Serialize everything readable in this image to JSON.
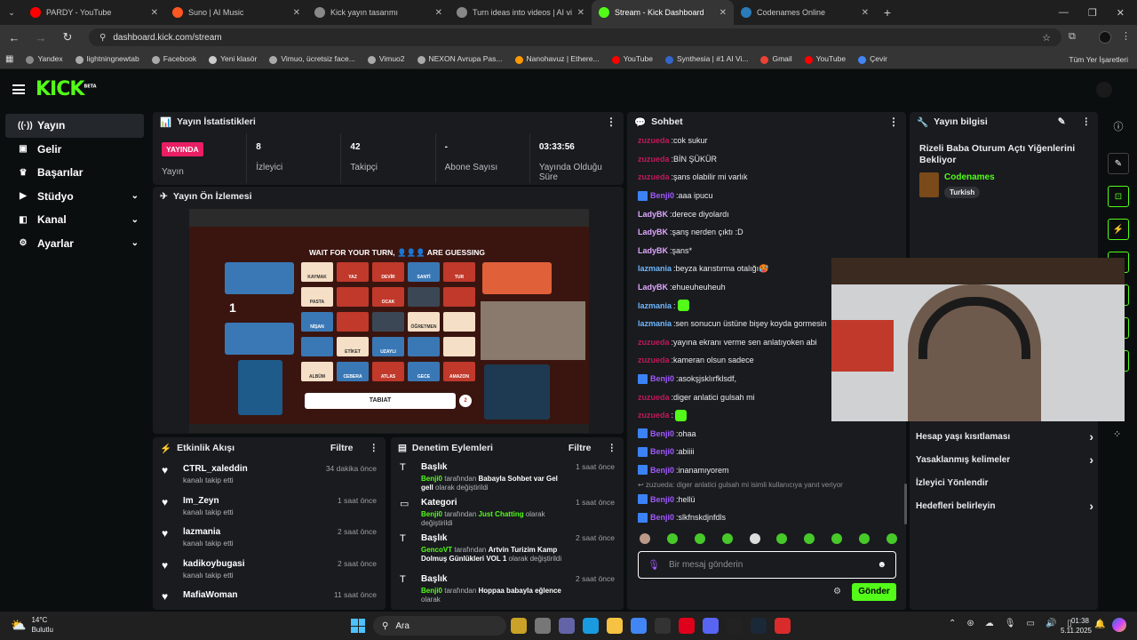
{
  "browser": {
    "tabs": [
      {
        "title": "PARDY - YouTube",
        "color": "#ff0000",
        "active": false
      },
      {
        "title": "Suno | AI Music",
        "color": "#ff5722",
        "active": false
      },
      {
        "title": "Kick yayın tasarımı",
        "color": "#888888",
        "active": false
      },
      {
        "title": "Turn ideas into videos | AI vide",
        "color": "#888888",
        "active": false
      },
      {
        "title": "Stream - Kick Dashboard",
        "color": "#53fc18",
        "active": true
      },
      {
        "title": "Codenames Online",
        "color": "#2b7bb9",
        "active": false
      }
    ],
    "url": "dashboard.kick.com/stream",
    "bookmarks": [
      "Yandex",
      "lightningnewtab",
      "Facebook",
      "Yeni klasör",
      "Vimuo, ücretsiz face...",
      "Vimuo2",
      "NEXON Avrupa Pas...",
      "Nanohavuz | Ethere...",
      "YouTube",
      "Synthesia | #1 AI Vi...",
      "Gmail",
      "YouTube",
      "Çevir"
    ],
    "all_bookmarks": "Tüm Yer İşaretleri"
  },
  "logo": {
    "text": "KICK",
    "tag": "BETA"
  },
  "sidebar": [
    {
      "label": "Yayın",
      "icon": "stream-icon",
      "glyph": "((·))",
      "active": true,
      "chevron": false
    },
    {
      "label": "Gelir",
      "icon": "wallet-icon",
      "glyph": "▣",
      "active": false,
      "chevron": false
    },
    {
      "label": "Başarılar",
      "icon": "trophy-icon",
      "glyph": "♛",
      "active": false,
      "chevron": false
    },
    {
      "label": "Stüdyo",
      "icon": "video-icon",
      "glyph": "▶",
      "active": false,
      "chevron": true
    },
    {
      "label": "Kanal",
      "icon": "channel-icon",
      "glyph": "◧",
      "active": false,
      "chevron": true
    },
    {
      "label": "Ayarlar",
      "icon": "gear-icon",
      "glyph": "⚙",
      "active": false,
      "chevron": true
    }
  ],
  "stats": {
    "title": "Yayın İstatistikleri",
    "live_badge": "YAYINDA",
    "items": [
      {
        "value": "8",
        "label": "İzleyici"
      },
      {
        "value": "42",
        "label": "Takipçi"
      },
      {
        "value": "-",
        "label": "Abone Sayısı"
      },
      {
        "value": "03:33:56",
        "label": "Yayında Olduğu Süre"
      }
    ],
    "live_label": "Yayın"
  },
  "preview": {
    "title": "Yayın Ön İzlemesi",
    "game_heading": "WAIT FOR YOUR TURN, 👤👤👤 ARE GUESSING",
    "clue": "TABIAT",
    "clue_count": "2",
    "team_score": "1",
    "cards": [
      "KAYMAK",
      "YAZ",
      "DEVİR",
      "SANTİ",
      "TUR",
      "PASTA",
      "",
      "OCAK",
      "",
      "",
      "NİŞAN",
      "",
      "",
      "ÖĞRETMEN",
      "",
      "",
      "ETİKET",
      "UZAYLI",
      "",
      "",
      "ALBÜM",
      "CEBERA",
      "ATLAS",
      "GECE",
      "AMAZON"
    ],
    "card_colors": [
      "cream",
      "red",
      "red",
      "blue",
      "red",
      "cream",
      "red",
      "red",
      "dark",
      "red",
      "blue",
      "red",
      "dark",
      "cream",
      "cream",
      "blue",
      "cream",
      "blue",
      "blue",
      "cream",
      "cream",
      "blue",
      "red",
      "blue",
      "red"
    ]
  },
  "events": {
    "title": "Etkinlik Akışı",
    "filter": "Filtre",
    "items": [
      {
        "name": "CTRL_xaleddin",
        "action": "kanalı takip etti",
        "time": "34 dakika önce"
      },
      {
        "name": "Im_Zeyn",
        "action": "kanalı takip etti",
        "time": "1 saat önce"
      },
      {
        "name": "lazmania",
        "action": "kanalı takip etti",
        "time": "2 saat önce"
      },
      {
        "name": "kadikoybugasi",
        "action": "kanalı takip etti",
        "time": "2 saat önce"
      },
      {
        "name": "MafiaWoman",
        "action": "",
        "time": "11 saat önce"
      }
    ]
  },
  "moderation": {
    "title": "Denetim Eylemleri",
    "filter": "Filtre",
    "items": [
      {
        "type": "Başlık",
        "icon": "text-icon",
        "glyph": "T",
        "user": "Benji0",
        "mid": " tarafından ",
        "value": "Babayla Sohbet var Gel gell",
        "end": " olarak değiştirildi",
        "time": "1 saat önce"
      },
      {
        "type": "Kategori",
        "icon": "category-icon",
        "glyph": "▭",
        "user": "Benji0",
        "mid": " tarafından ",
        "value": "Just Chatting",
        "end": " olarak değiştirildi",
        "time": "1 saat önce"
      },
      {
        "type": "Başlık",
        "icon": "text-icon",
        "glyph": "T",
        "user": "GencoVT",
        "mid": " tarafından ",
        "value": "Artvin Turizim Kamp Dolmuş Günlükleri VOL 1",
        "end": " olarak değiştirildi",
        "time": "2 saat önce"
      },
      {
        "type": "Başlık",
        "icon": "text-icon",
        "glyph": "T",
        "user": "Benji0",
        "mid": " tarafından ",
        "value": "Hoppaa babayla eğlence",
        "end": " olarak",
        "time": "2 saat önce"
      }
    ]
  },
  "chat": {
    "title": "Sohbet",
    "messages": [
      {
        "user": "zuzueda",
        "cls": "u-red",
        "text": "cok sukur",
        "badge": false,
        "emote": false
      },
      {
        "user": "zuzueda",
        "cls": "u-red",
        "text": "BİN ŞÜKÜR",
        "badge": false,
        "emote": false
      },
      {
        "user": "zuzueda",
        "cls": "u-red",
        "text": "şans olabilir mi varlık",
        "badge": false,
        "emote": false
      },
      {
        "user": "Benji0",
        "cls": "u-purple",
        "text": "aaa ipucu",
        "badge": true,
        "emote": false
      },
      {
        "user": "LadyBK",
        "cls": "u-pink",
        "text": "derece diyolardı",
        "badge": false,
        "emote": false
      },
      {
        "user": "LadyBK",
        "cls": "u-pink",
        "text": "şanş nerden çıktı :D",
        "badge": false,
        "emote": false
      },
      {
        "user": "LadyBK",
        "cls": "u-pink",
        "text": "şans*",
        "badge": false,
        "emote": false
      },
      {
        "user": "lazmania",
        "cls": "u-blue",
        "text": "beyza karıstırma otalığı🥵",
        "badge": false,
        "emote": false
      },
      {
        "user": "LadyBK",
        "cls": "u-pink",
        "text": "ehueuheuheuh",
        "badge": false,
        "emote": false
      },
      {
        "user": "lazmania",
        "cls": "u-blue",
        "text": "",
        "badge": false,
        "emote": true
      },
      {
        "user": "lazmania",
        "cls": "u-blue",
        "text": "sen sonucun üstüne bişey koyda gormesin",
        "badge": false,
        "emote": false
      },
      {
        "user": "zuzueda",
        "cls": "u-red",
        "text": "yayına ekranı verme sen anlatıyoken abi",
        "badge": false,
        "emote": false
      },
      {
        "user": "zuzueda",
        "cls": "u-red",
        "text": "kameran olsun sadece",
        "badge": false,
        "emote": false
      },
      {
        "user": "Benji0",
        "cls": "u-purple",
        "text": "asokşjsklırfklsdf,",
        "badge": true,
        "emote": false
      },
      {
        "user": "zuzueda",
        "cls": "u-red",
        "text": "diger anlatici gulsah mi",
        "badge": false,
        "emote": false
      },
      {
        "user": "zuzueda",
        "cls": "u-red",
        "text": "",
        "badge": false,
        "emote": true
      },
      {
        "user": "Benji0",
        "cls": "u-purple",
        "text": "ohaa",
        "badge": true,
        "emote": false
      },
      {
        "user": "Benji0",
        "cls": "u-purple",
        "text": "abiiii",
        "badge": true,
        "emote": false
      },
      {
        "user": "Benji0",
        "cls": "u-purple",
        "text": "inanamıyorem",
        "badge": true,
        "emote": false
      }
    ],
    "reply_line": "↩ zuzueda: diger anlatici gulsah mi isimli kullanıcıya yanıt veriyor",
    "after_reply": [
      {
        "user": "Benji0",
        "cls": "u-purple",
        "text": "hellü",
        "badge": true,
        "emote": false
      },
      {
        "user": "Benji0",
        "cls": "u-purple",
        "text": "slkfnskdjnfdls",
        "badge": true,
        "emote": false
      }
    ],
    "placeholder": "Bir mesaj gönderin",
    "send": "Gönder"
  },
  "info": {
    "title": "Yayın bilgisi",
    "stream_title": "Rizeli Baba Oturum Açtı Yiğenlerini Bekliyor",
    "category": "Codenames",
    "language": "Turkish",
    "links": [
      {
        "label": "Hesap yaşı kısıtlaması",
        "chevron": true
      },
      {
        "label": "Yasaklanmış kelimeler",
        "chevron": true
      },
      {
        "label": "İzleyici Yönlendir",
        "chevron": false
      },
      {
        "label": "Hedefleri belirleyin",
        "chevron": true
      }
    ]
  },
  "taskbar": {
    "temp": "14°C",
    "weather": "Bulutlu",
    "search": "Ara",
    "time": "01:38",
    "date": "5.11.2025"
  }
}
